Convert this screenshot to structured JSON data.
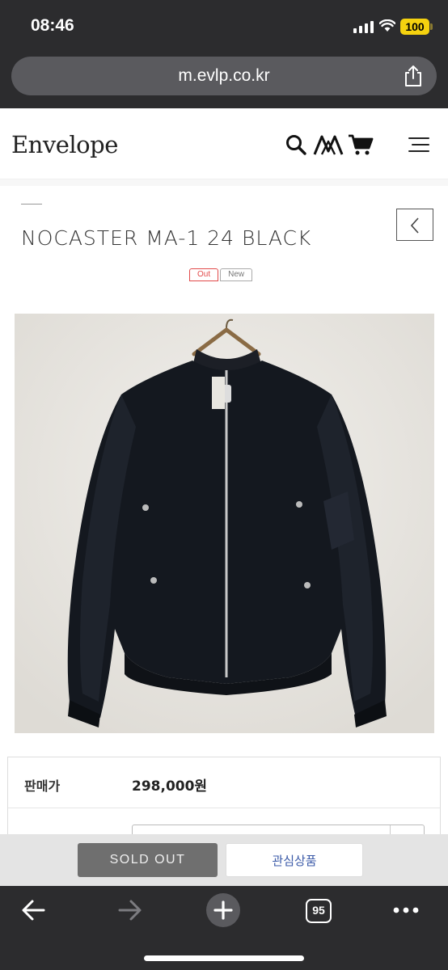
{
  "status_bar": {
    "time": "08:46",
    "battery": "100"
  },
  "browser": {
    "url": "m.evlp.co.kr",
    "tab_count": "95"
  },
  "site": {
    "logo": "Envelope"
  },
  "product": {
    "title": "NOCASTER MA-1 24 BLACK",
    "badges": {
      "out": "Out",
      "new": "New"
    },
    "image_alt": "Black MA-1 bomber jacket on hanger against white wall"
  },
  "pricing": {
    "label": "판매가",
    "value": "298,000원"
  },
  "actions": {
    "sold_out": "SOLD OUT",
    "wishlist": "관심상품"
  },
  "colors": {
    "chrome": "#2c2c2e",
    "accent_out": "#e24a4a",
    "wishlist_text": "#3b5aa8",
    "battery": "#f5d20f"
  }
}
